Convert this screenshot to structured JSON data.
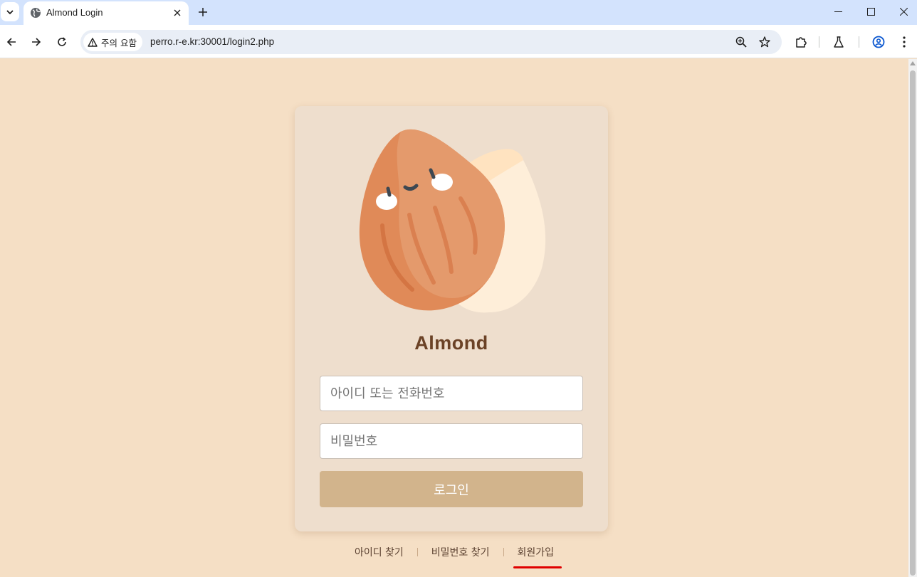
{
  "browser": {
    "tab_title": "Almond Login",
    "security_label": "주의 요함",
    "url": "perro.r-e.kr:30001/login2.php"
  },
  "page": {
    "brand": "Almond",
    "id_placeholder": "아이디 또는 전화번호",
    "password_placeholder": "비밀번호",
    "login_label": "로그인",
    "links": {
      "find_id": "아이디 찾기",
      "find_password": "비밀번호 찾기",
      "signup": "회원가입"
    }
  },
  "colors": {
    "page_background": "#f5dfc5",
    "card_background": "#eedecd",
    "button": "#d2b48c",
    "brand_text": "#6b4226",
    "annotation_underline": "#e00000"
  },
  "icons": [
    "chevron-down-icon",
    "globe-icon",
    "close-icon",
    "plus-icon",
    "minimize-icon",
    "maximize-icon",
    "back-icon",
    "forward-icon",
    "reload-icon",
    "warning-icon",
    "zoom-icon",
    "star-icon",
    "extensions-icon",
    "labs-flask-icon",
    "profile-icon",
    "menu-icon",
    "almond-logo"
  ]
}
